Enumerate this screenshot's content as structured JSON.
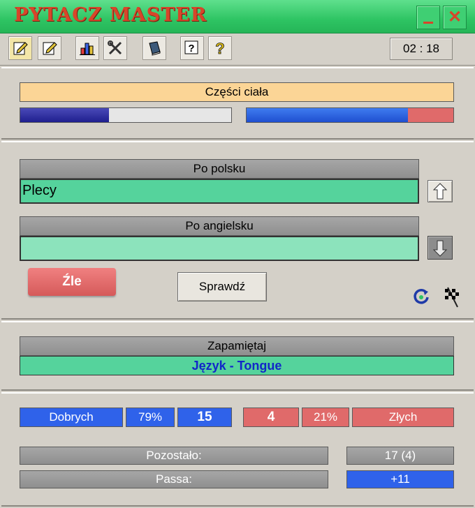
{
  "app": {
    "title": "PYTACZ MASTER",
    "minimize_icon": "minimize-icon",
    "close_icon": "close-icon",
    "close_glyph": "✕"
  },
  "toolbar": {
    "icons": [
      "edit-notepad-icon",
      "edit-notepad-alt-icon",
      "statistics-chart-icon",
      "tools-settings-icon",
      "dictionary-book-icon",
      "help-question-icon",
      "about-info-icon"
    ],
    "timer": "02 : 18"
  },
  "category": {
    "label": "Części ciała",
    "progress_left": 0.42,
    "progress_right": 0.78
  },
  "quiz": {
    "polish_header": "Po polsku",
    "polish_value": "Plecy",
    "english_header": "Po angielsku",
    "english_value": "",
    "result_label": "Źle",
    "check_button": "Sprawdź",
    "icons": [
      "arrow-up-icon",
      "arrow-down-icon",
      "restart-icon",
      "finish-flag-icon"
    ]
  },
  "memorize": {
    "header": "Zapamiętaj",
    "value": "Język - Tongue"
  },
  "stats": {
    "good_label": "Dobrych",
    "good_percent": "79%",
    "good_count": "15",
    "bad_count": "4",
    "bad_percent": "21%",
    "bad_label": "Złych",
    "remaining_label": "Pozostało:",
    "remaining_value": "17 (4)",
    "streak_label": "Passa:",
    "streak_value": "+11"
  },
  "colors": {
    "accent_green": "#2ec463",
    "title_red": "#d8452a",
    "field_green": "#55d39c",
    "good_blue": "#2f62ea",
    "bad_red": "#e06a6a"
  }
}
